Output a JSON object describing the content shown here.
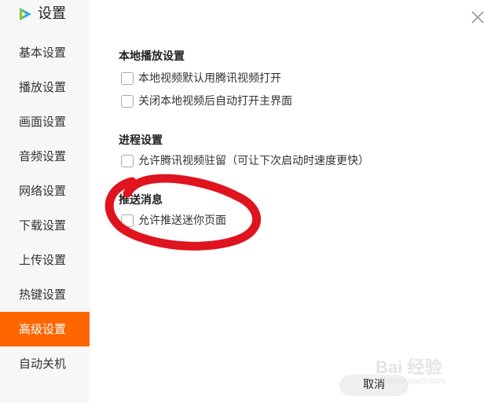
{
  "window": {
    "title": "设置"
  },
  "sidebar": {
    "items": [
      {
        "label": "基本设置",
        "active": false
      },
      {
        "label": "播放设置",
        "active": false
      },
      {
        "label": "画面设置",
        "active": false
      },
      {
        "label": "音频设置",
        "active": false
      },
      {
        "label": "网络设置",
        "active": false
      },
      {
        "label": "下载设置",
        "active": false
      },
      {
        "label": "上传设置",
        "active": false
      },
      {
        "label": "热键设置",
        "active": false
      },
      {
        "label": "高级设置",
        "active": true
      },
      {
        "label": "自动关机",
        "active": false
      }
    ]
  },
  "sections": {
    "local_playback": {
      "title": "本地播放设置",
      "options": [
        {
          "label": "本地视频默认用腾讯视频打开",
          "checked": false
        },
        {
          "label": "关闭本地视频后自动打开主界面",
          "checked": false
        }
      ]
    },
    "process": {
      "title": "进程设置",
      "options": [
        {
          "label": "允许腾讯视频驻留（可让下次启动时速度更快）",
          "checked": false
        }
      ]
    },
    "push": {
      "title": "推送消息",
      "options": [
        {
          "label": "允许推送迷你页面",
          "checked": false
        }
      ]
    }
  },
  "footer": {
    "cancel_label": "取消"
  },
  "watermark": {
    "brand": "Bai 经验",
    "url": "jingyan.baidu.com"
  },
  "colors": {
    "accent": "#ff6600",
    "annotation": "#e0141e",
    "sidebar_bg": "#f7f7f7"
  }
}
